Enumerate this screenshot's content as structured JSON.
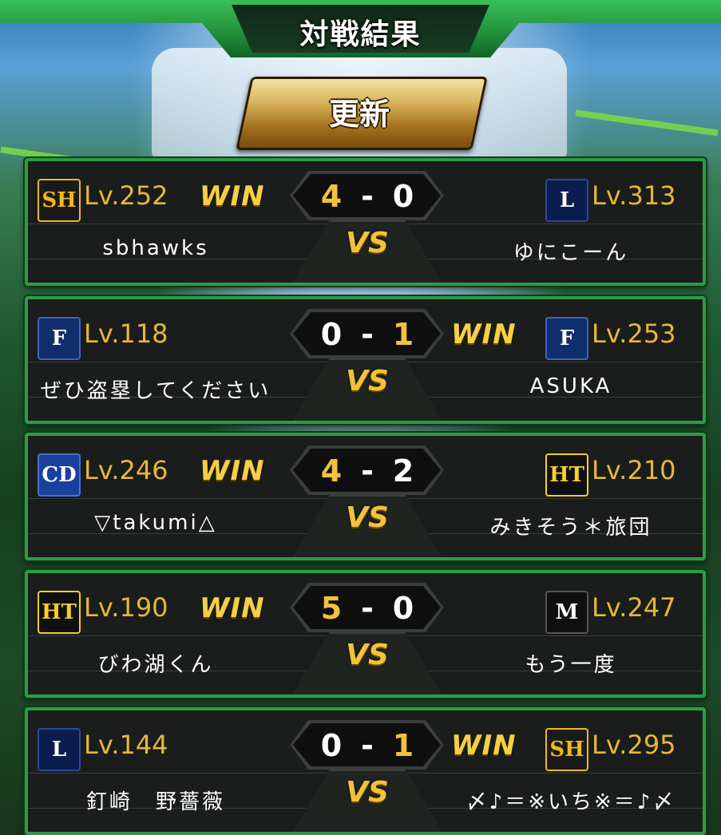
{
  "title": "対戦結果",
  "refresh_label": "更新",
  "vs_label": "VS",
  "win_label": "WIN",
  "dash": "-",
  "matches": [
    {
      "left": {
        "team": "hawks",
        "logo": "SH",
        "level": "Lv.252",
        "name": "sbhawks",
        "win": true
      },
      "right": {
        "team": "lions",
        "logo": "L",
        "level": "Lv.313",
        "name": "ゆにこーん",
        "win": false
      },
      "score_left": "4",
      "score_right": "0"
    },
    {
      "left": {
        "team": "fighters",
        "logo": "F",
        "level": "Lv.118",
        "name": "ぜひ盗塁してください",
        "win": false
      },
      "right": {
        "team": "fighters",
        "logo": "F",
        "level": "Lv.253",
        "name": "ASUKA",
        "win": true
      },
      "score_left": "0",
      "score_right": "1"
    },
    {
      "left": {
        "team": "dragons",
        "logo": "CD",
        "level": "Lv.246",
        "name": "▽takumi△",
        "win": true
      },
      "right": {
        "team": "tigers",
        "logo": "HT",
        "level": "Lv.210",
        "name": "みきそう＊旅団",
        "win": false
      },
      "score_left": "4",
      "score_right": "2"
    },
    {
      "left": {
        "team": "tigers",
        "logo": "HT",
        "level": "Lv.190",
        "name": "びわ湖くん",
        "win": true
      },
      "right": {
        "team": "marines",
        "logo": "M",
        "level": "Lv.247",
        "name": "もう一度",
        "win": false
      },
      "score_left": "5",
      "score_right": "0"
    },
    {
      "left": {
        "team": "lions",
        "logo": "L",
        "level": "Lv.144",
        "name": "釘崎　野薔薇",
        "win": false
      },
      "right": {
        "team": "hawks",
        "logo": "SH",
        "level": "Lv.295",
        "name": "〆♪＝※いち※＝♪〆",
        "win": true
      },
      "score_left": "0",
      "score_right": "1"
    }
  ],
  "colors": {
    "winner_score": "#f2c23b",
    "loser_score": "#ffffff",
    "card_border": "#2f9a45",
    "level_text": "#e6b83a"
  }
}
